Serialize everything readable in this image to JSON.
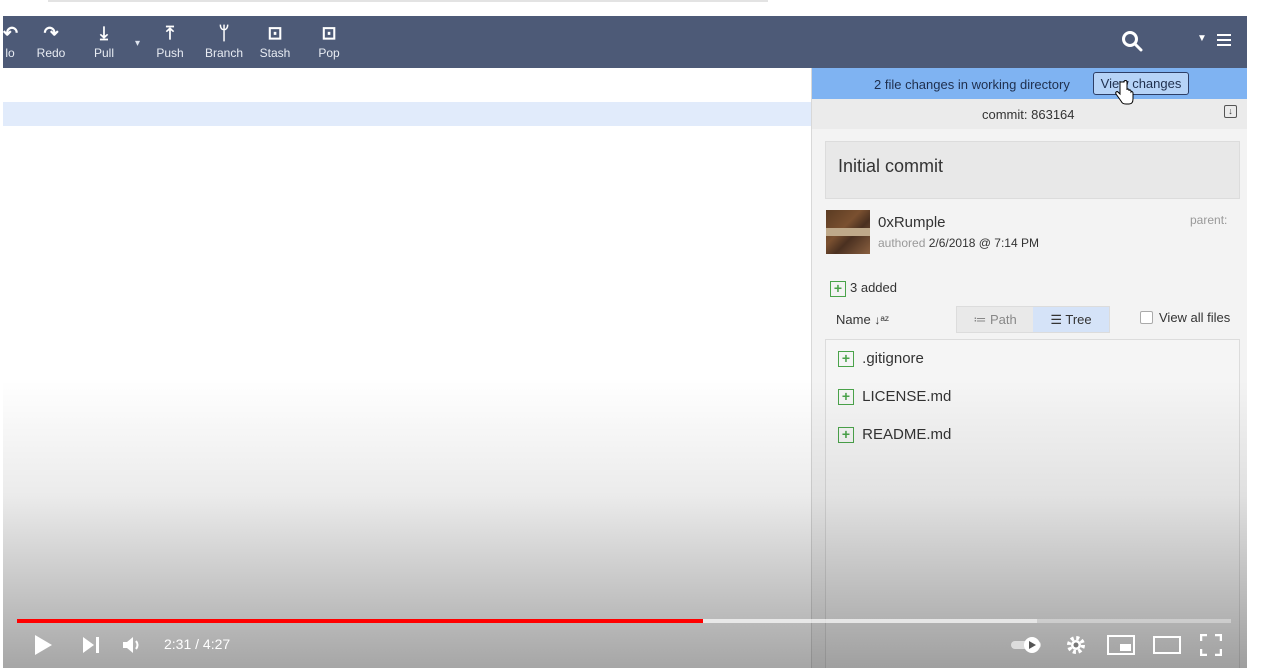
{
  "toolbar": {
    "undo_label": "lo",
    "redo_label": "Redo",
    "pull_label": "Pull",
    "push_label": "Push",
    "branch_label": "Branch",
    "stash_label": "Stash",
    "pop_label": "Pop"
  },
  "panel": {
    "wip_text": "2 file changes in working directory",
    "view_changes_label": "View changes",
    "commit_label": "commit:",
    "commit_sha": "863164",
    "message": "Initial commit",
    "author": "0xRumple",
    "authored_label": "authored",
    "authored_date": "2/6/2018 @ 7:14 PM",
    "parent_label": "parent:",
    "added_text": "3 added",
    "name_label": "Name",
    "path_label": "Path",
    "tree_label": "Tree",
    "view_all_label": "View all files",
    "files": [
      ".gitignore",
      "LICENSE.md",
      "README.md"
    ]
  },
  "player": {
    "current_time": "2:31",
    "duration": "4:27",
    "time_display": "2:31 / 4:27",
    "progress_fraction": 0.565,
    "buffered_fraction": 0.84,
    "accent_color": "#ff0000"
  }
}
